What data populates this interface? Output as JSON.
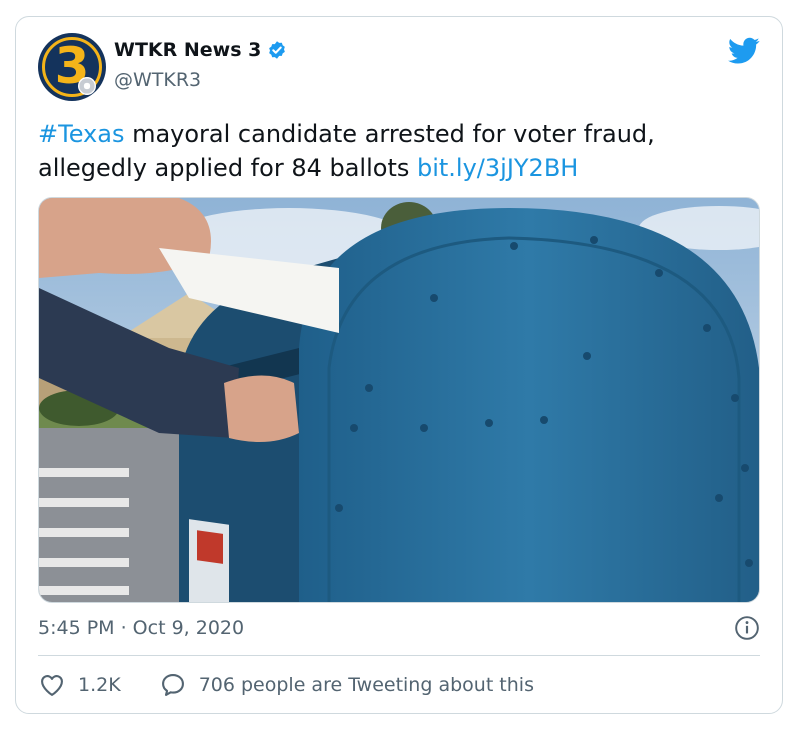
{
  "account": {
    "name": "WTKR News 3",
    "handle": "@WTKR3",
    "avatar_text": "3"
  },
  "tweet": {
    "hashtag": "#Texas",
    "text": " mayoral candidate arrested for voter fraud, allegedly applied for 84 ballots ",
    "link": "bit.ly/3jJY2BH",
    "timestamp": "5:45 PM · Oct 9, 2020"
  },
  "stats": {
    "likes": "1.2K",
    "conversation": "706 people are Tweeting about this"
  },
  "icons": {
    "verified": "verified-badge-icon",
    "brand": "twitter-bird-icon",
    "info": "info-icon",
    "like": "heart-icon",
    "reply": "speech-bubble-icon"
  },
  "colors": {
    "link": "#1b95e0",
    "verified": "#1d9bf0",
    "secondary_text": "#536471",
    "border": "#cfd9de"
  }
}
